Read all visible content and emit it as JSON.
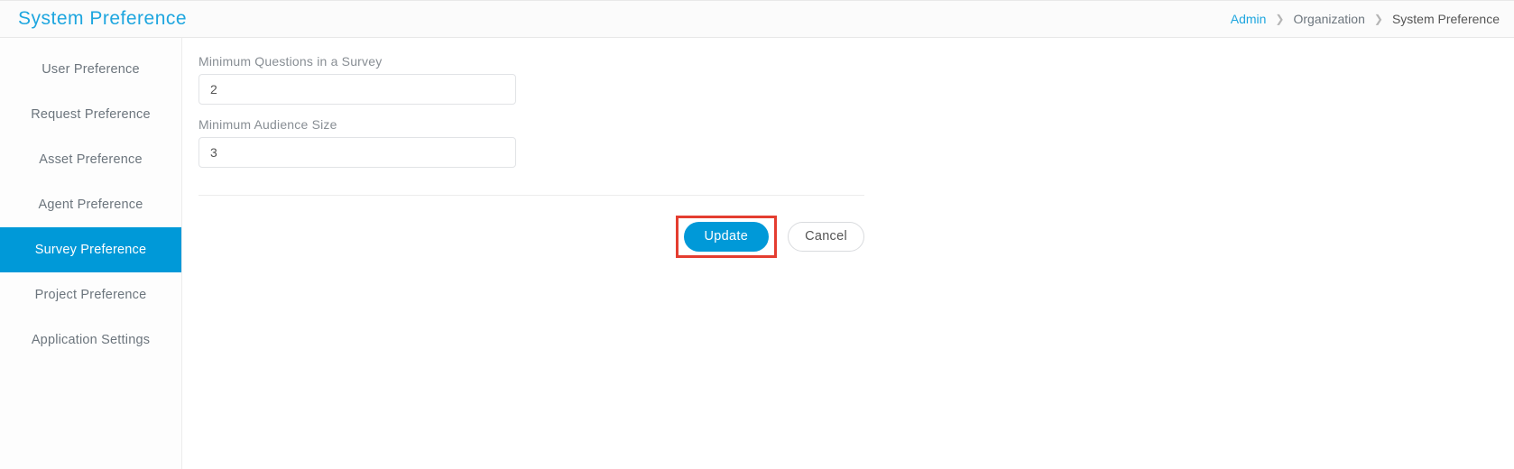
{
  "header": {
    "title": "System Preference",
    "breadcrumb": {
      "admin": "Admin",
      "org": "Organization",
      "current": "System Preference"
    }
  },
  "sidebar": {
    "items": [
      {
        "label": "User Preference"
      },
      {
        "label": "Request Preference"
      },
      {
        "label": "Asset Preference"
      },
      {
        "label": "Agent Preference"
      },
      {
        "label": "Survey Preference"
      },
      {
        "label": "Project Preference"
      },
      {
        "label": "Application Settings"
      }
    ]
  },
  "form": {
    "min_questions": {
      "label": "Minimum Questions in a Survey",
      "value": "2"
    },
    "min_audience": {
      "label": "Minimum Audience Size",
      "value": "3"
    }
  },
  "actions": {
    "update": "Update",
    "cancel": "Cancel"
  }
}
